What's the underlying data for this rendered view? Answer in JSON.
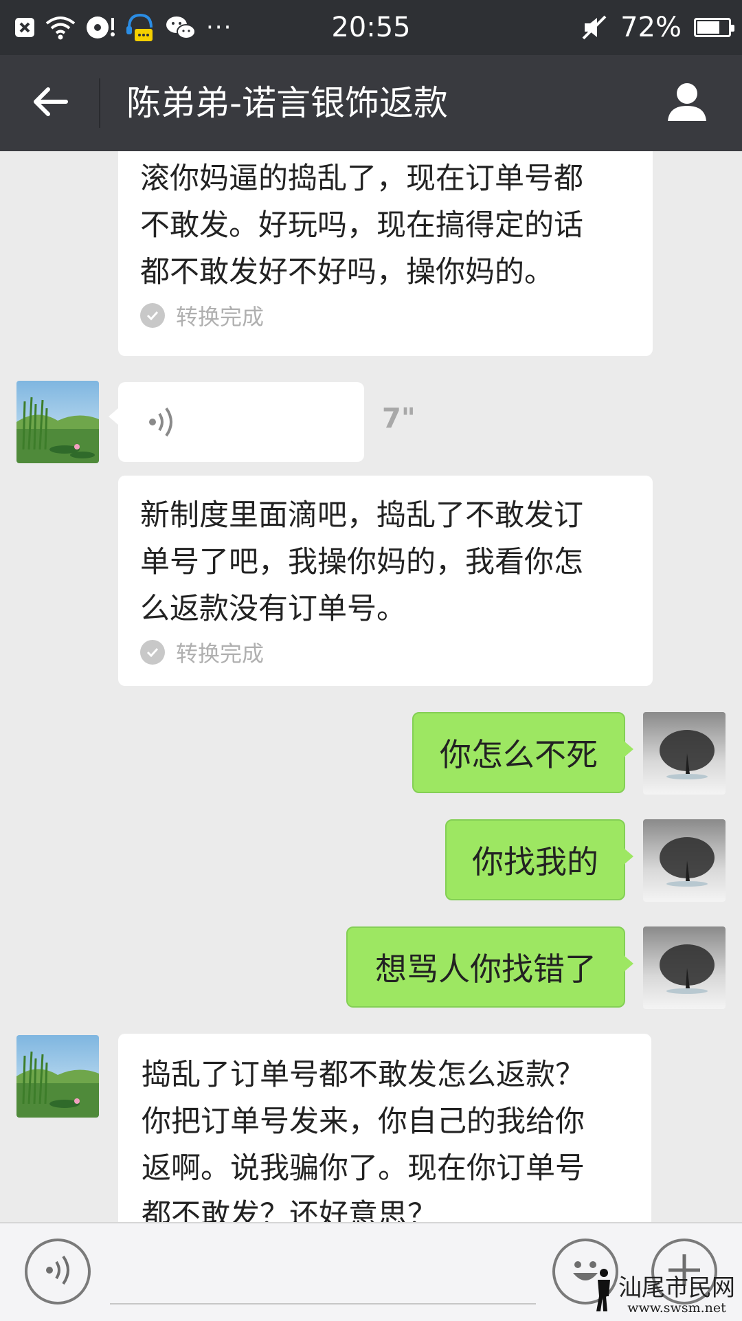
{
  "status_bar": {
    "time": "20:55",
    "battery_percent": "72%",
    "battery_level": 0.72,
    "left_icons": [
      "close-box-icon",
      "wifi-icon",
      "music-disc-icon",
      "chat-robot-icon",
      "wechat-icon",
      "more-dots-icon"
    ],
    "more_text": "···"
  },
  "header": {
    "title": "陈弟弟-诺言银饰返款",
    "back_icon": "arrow-left-icon",
    "profile_icon": "person-icon"
  },
  "messages": [
    {
      "side": "in",
      "type": "voice-transcript",
      "text": "滚你妈逼的捣乱了，现在订单号都不敢发。好玩吗，现在搞得定的话都不敢发好不好吗，操你妈的。",
      "lines": [
        "滚你妈逼的捣乱了，现在订单号都",
        "不敢发。好玩吗，现在搞得定的话",
        "都不敢发好不好吗，操你妈的。"
      ],
      "status": "转换完成"
    },
    {
      "side": "in",
      "type": "voice",
      "duration": "7\""
    },
    {
      "side": "in",
      "type": "voice-transcript",
      "lines": [
        "新制度里面滴吧，捣乱了不敢发订",
        "单号了吧，我操你妈的，我看你怎",
        "么返款没有订单号。"
      ],
      "status": "转换完成"
    },
    {
      "side": "out",
      "type": "text",
      "text": "你怎么不死"
    },
    {
      "side": "out",
      "type": "text",
      "text": "你找我的"
    },
    {
      "side": "out",
      "type": "text",
      "text": "想骂人你找错了"
    },
    {
      "side": "in",
      "type": "text",
      "lines": [
        "捣乱了订单号都不敢发怎么返款？",
        "你把订单号发来，你自己的我给你",
        "返啊。说我骗你了。现在你订单号",
        "都不敢发？还好意思？"
      ]
    }
  ],
  "bottom_bar": {
    "voice_icon": "voice-input-icon",
    "emoji_icon": "emoji-smile-icon",
    "plus_icon": "plus-icon"
  },
  "watermark": {
    "title": "汕尾市民网",
    "url": "www.swsm.net"
  },
  "colors": {
    "status_bar": "#2e3034",
    "title_bar": "#393a3f",
    "chat_bg": "#ebebeb",
    "bubble_out": "#9de762",
    "bubble_in": "#ffffff"
  }
}
